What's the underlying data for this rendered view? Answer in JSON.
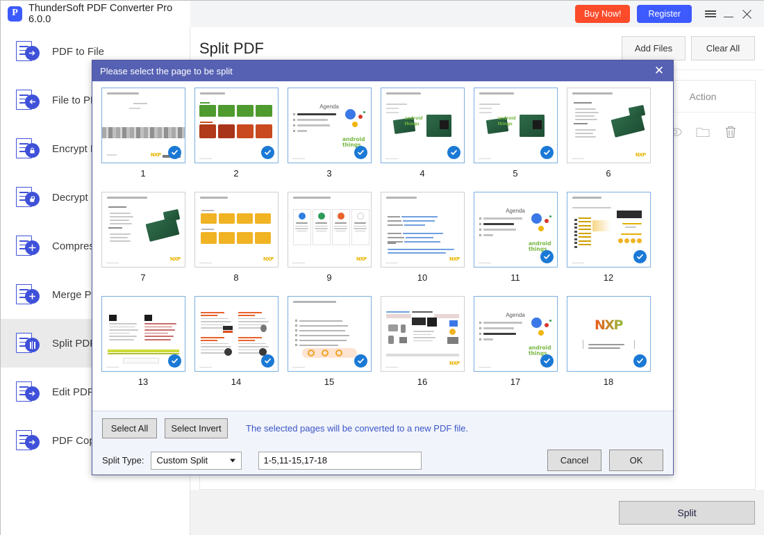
{
  "titlebar": {
    "app_title": "ThunderSoft PDF Converter Pro 6.0.0",
    "logo_letter": "P",
    "buy_label": "Buy Now!",
    "register_label": "Register"
  },
  "sidebar": {
    "items": [
      {
        "label": "PDF to File",
        "icon": "arrow-right",
        "active": false
      },
      {
        "label": "File to PDF",
        "icon": "arrow-left",
        "active": false
      },
      {
        "label": "Encrypt PDF",
        "icon": "lock",
        "active": false
      },
      {
        "label": "Decrypt PDF",
        "icon": "unlock",
        "active": false
      },
      {
        "label": "Compress PDF",
        "icon": "plus-cross",
        "active": false
      },
      {
        "label": "Merge PDF",
        "icon": "plus",
        "active": false
      },
      {
        "label": "Split PDF",
        "icon": "split",
        "active": true
      },
      {
        "label": "Edit PDF",
        "icon": "arrow-right",
        "active": false
      },
      {
        "label": "PDF Copy Protect",
        "icon": "arrow-right",
        "active": false
      }
    ]
  },
  "main": {
    "page_title": "Split PDF",
    "add_files_label": "Add Files",
    "clear_all_label": "Clear All",
    "action_column_label": "Action",
    "split_button_label": "Split"
  },
  "dialog": {
    "title": "Please select the page to be split",
    "close_glyph": "✕",
    "select_all_label": "Select All",
    "select_invert_label": "Select Invert",
    "hint": "The selected pages will be converted to a new PDF file.",
    "split_type_label": "Split Type:",
    "split_type_value": "Custom Split",
    "pages_value": "1-5,11-15,17-18",
    "pages_placeholder": "",
    "cancel_label": "Cancel",
    "ok_label": "OK",
    "accent_color": "#5661b3",
    "selected_border_color": "#7aaee0",
    "check_color": "#1b79d6",
    "pages": [
      {
        "num": "1",
        "selected": true,
        "kind": "title"
      },
      {
        "num": "2",
        "selected": true,
        "kind": "flow-green-red"
      },
      {
        "num": "3",
        "selected": true,
        "kind": "agenda",
        "active_item": 0
      },
      {
        "num": "4",
        "selected": true,
        "kind": "boards"
      },
      {
        "num": "5",
        "selected": true,
        "kind": "boards"
      },
      {
        "num": "6",
        "selected": false,
        "kind": "board-text"
      },
      {
        "num": "7",
        "selected": false,
        "kind": "board-text"
      },
      {
        "num": "8",
        "selected": false,
        "kind": "flow-yellow"
      },
      {
        "num": "9",
        "selected": false,
        "kind": "four-cards"
      },
      {
        "num": "10",
        "selected": false,
        "kind": "links"
      },
      {
        "num": "11",
        "selected": true,
        "kind": "agenda",
        "active_item": 1
      },
      {
        "num": "12",
        "selected": true,
        "kind": "roadmap"
      },
      {
        "num": "13",
        "selected": true,
        "kind": "two-panel"
      },
      {
        "num": "14",
        "selected": true,
        "kind": "quad"
      },
      {
        "num": "15",
        "selected": true,
        "kind": "bullets"
      },
      {
        "num": "16",
        "selected": false,
        "kind": "apps"
      },
      {
        "num": "17",
        "selected": true,
        "kind": "agenda",
        "active_item": 2
      },
      {
        "num": "18",
        "selected": true,
        "kind": "logo"
      }
    ]
  }
}
